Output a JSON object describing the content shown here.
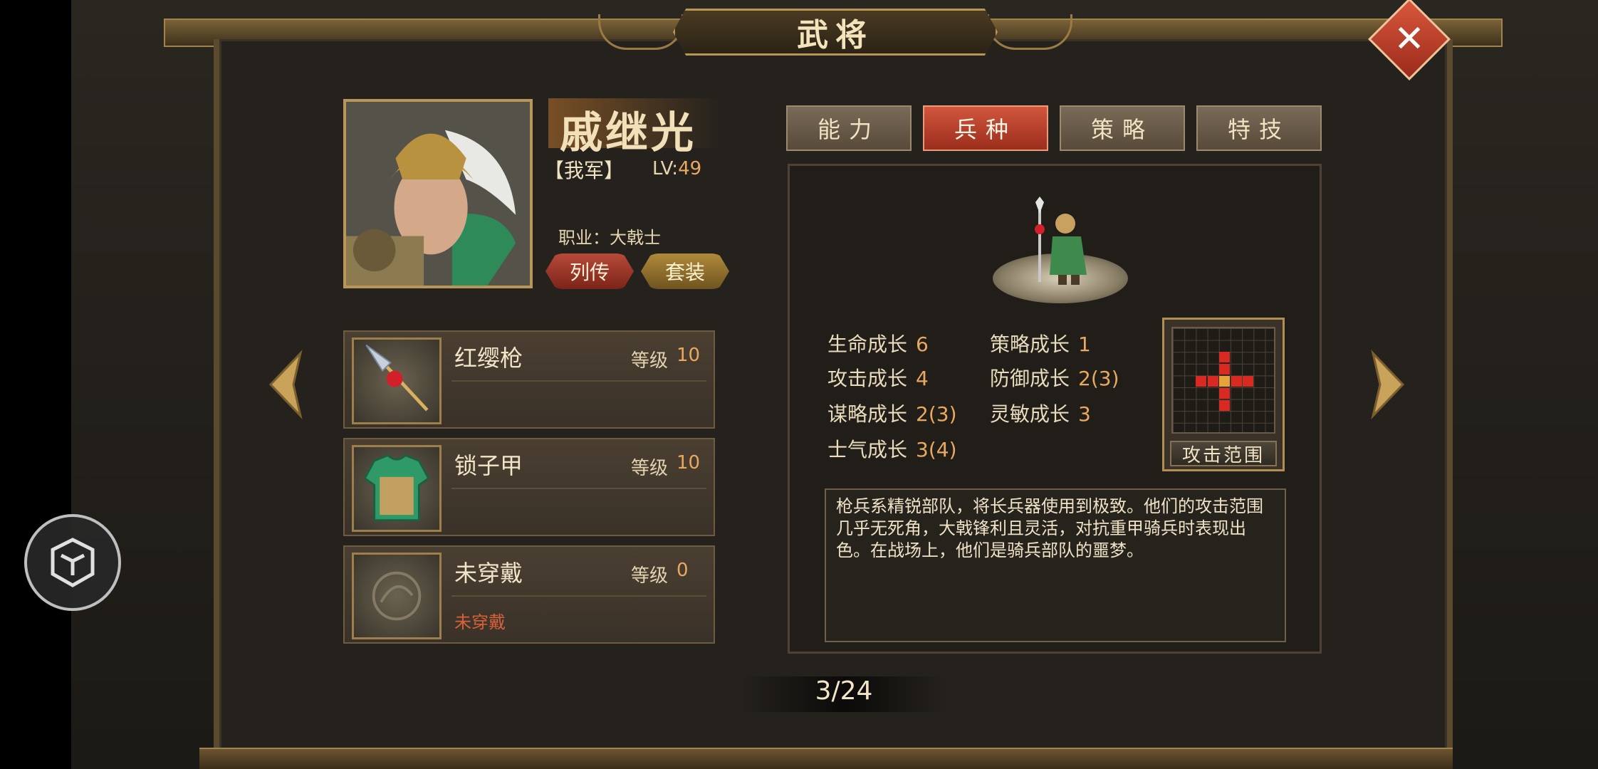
{
  "window": {
    "title": "武将"
  },
  "hero": {
    "name": "戚继光",
    "faction": "【我军】",
    "lv_label": "LV:",
    "lv_value": "49",
    "job": "职业：大戟士",
    "buttons": {
      "biography": "列传",
      "set": "套装"
    }
  },
  "equipment": [
    {
      "name": "红缨枪",
      "level_label": "等级",
      "level": "10",
      "note": "",
      "icon": "spear-icon"
    },
    {
      "name": "锁子甲",
      "level_label": "等级",
      "level": "10",
      "note": "",
      "icon": "armor-icon"
    },
    {
      "name": "未穿戴",
      "level_label": "等级",
      "level": "0",
      "note": "未穿戴",
      "icon": "empty-slot-icon"
    }
  ],
  "tabs": [
    {
      "label": "能力",
      "active": false
    },
    {
      "label": "兵种",
      "active": true
    },
    {
      "label": "策略",
      "active": false
    },
    {
      "label": "特技",
      "active": false
    }
  ],
  "unit": {
    "stats": {
      "hp_label": "生命成长",
      "hp": "6",
      "strategy_label": "策略成长",
      "strategy": "1",
      "atk_label": "攻击成长",
      "atk": "4",
      "def_label": "防御成长",
      "def": "2(3)",
      "int_label": "谋略成长",
      "int": "2(3)",
      "agi_label": "灵敏成长",
      "agi": "3",
      "morale_label": "士气成长",
      "morale": "3(4)"
    },
    "range_label": "攻击范围",
    "description": "枪兵系精锐部队，将长兵器使用到极致。他们的攻击范围几乎无死角，大戟锋利且灵活，对抗重甲骑兵时表现出色。在战场上，他们是骑兵部队的噩梦。"
  },
  "pagination": {
    "text": "3/24"
  },
  "colors": {
    "accent_red": "#c9472f",
    "gold": "#b8965a",
    "value": "#e8a860"
  }
}
